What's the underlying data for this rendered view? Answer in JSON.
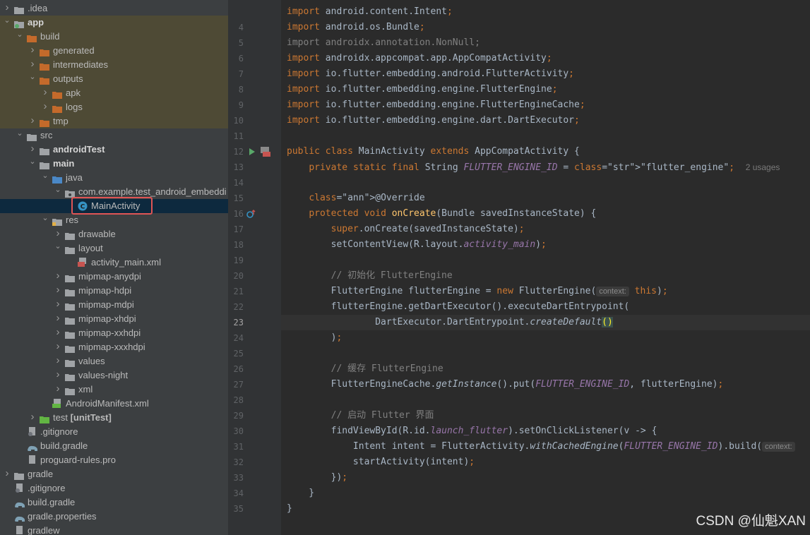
{
  "project_tree": [
    {
      "label": ".idea",
      "depth": 0,
      "arrow": "collapsed",
      "icon": "folder",
      "bold": false,
      "hl": false
    },
    {
      "label": "app",
      "depth": 0,
      "arrow": "expanded",
      "icon": "module",
      "bold": true,
      "hl": true
    },
    {
      "label": "build",
      "depth": 1,
      "arrow": "expanded",
      "icon": "folder-orange",
      "bold": false,
      "hl": true
    },
    {
      "label": "generated",
      "depth": 2,
      "arrow": "collapsed",
      "icon": "folder-orange",
      "bold": false,
      "hl": true
    },
    {
      "label": "intermediates",
      "depth": 2,
      "arrow": "collapsed",
      "icon": "folder-orange",
      "bold": false,
      "hl": true
    },
    {
      "label": "outputs",
      "depth": 2,
      "arrow": "expanded",
      "icon": "folder-orange",
      "bold": false,
      "hl": true
    },
    {
      "label": "apk",
      "depth": 3,
      "arrow": "collapsed",
      "icon": "folder-orange",
      "bold": false,
      "hl": true
    },
    {
      "label": "logs",
      "depth": 3,
      "arrow": "collapsed",
      "icon": "folder-orange",
      "bold": false,
      "hl": true
    },
    {
      "label": "tmp",
      "depth": 2,
      "arrow": "collapsed",
      "icon": "folder-orange",
      "bold": false,
      "hl": true
    },
    {
      "label": "src",
      "depth": 1,
      "arrow": "expanded",
      "icon": "folder",
      "bold": false,
      "hl": false
    },
    {
      "label": "androidTest",
      "depth": 2,
      "arrow": "collapsed",
      "icon": "folder",
      "bold": true,
      "hl": false
    },
    {
      "label": "main",
      "depth": 2,
      "arrow": "expanded",
      "icon": "folder",
      "bold": true,
      "hl": false
    },
    {
      "label": "java",
      "depth": 3,
      "arrow": "expanded",
      "icon": "folder-src",
      "bold": false,
      "hl": false
    },
    {
      "label": "com.example.test_android_embeddi",
      "depth": 4,
      "arrow": "expanded",
      "icon": "package",
      "bold": false,
      "hl": false
    },
    {
      "label": "MainActivity",
      "depth": 5,
      "arrow": "none",
      "icon": "class",
      "bold": false,
      "hl": false,
      "sel": true
    },
    {
      "label": "res",
      "depth": 3,
      "arrow": "expanded",
      "icon": "folder-res",
      "bold": false,
      "hl": false
    },
    {
      "label": "drawable",
      "depth": 4,
      "arrow": "collapsed",
      "icon": "folder",
      "bold": false,
      "hl": false
    },
    {
      "label": "layout",
      "depth": 4,
      "arrow": "expanded",
      "icon": "folder",
      "bold": false,
      "hl": false
    },
    {
      "label": "activity_main.xml",
      "depth": 5,
      "arrow": "none",
      "icon": "xml",
      "bold": false,
      "hl": false
    },
    {
      "label": "mipmap-anydpi",
      "depth": 4,
      "arrow": "collapsed",
      "icon": "folder",
      "bold": false,
      "hl": false
    },
    {
      "label": "mipmap-hdpi",
      "depth": 4,
      "arrow": "collapsed",
      "icon": "folder",
      "bold": false,
      "hl": false
    },
    {
      "label": "mipmap-mdpi",
      "depth": 4,
      "arrow": "collapsed",
      "icon": "folder",
      "bold": false,
      "hl": false
    },
    {
      "label": "mipmap-xhdpi",
      "depth": 4,
      "arrow": "collapsed",
      "icon": "folder",
      "bold": false,
      "hl": false
    },
    {
      "label": "mipmap-xxhdpi",
      "depth": 4,
      "arrow": "collapsed",
      "icon": "folder",
      "bold": false,
      "hl": false
    },
    {
      "label": "mipmap-xxxhdpi",
      "depth": 4,
      "arrow": "collapsed",
      "icon": "folder",
      "bold": false,
      "hl": false
    },
    {
      "label": "values",
      "depth": 4,
      "arrow": "collapsed",
      "icon": "folder",
      "bold": false,
      "hl": false
    },
    {
      "label": "values-night",
      "depth": 4,
      "arrow": "collapsed",
      "icon": "folder",
      "bold": false,
      "hl": false
    },
    {
      "label": "xml",
      "depth": 4,
      "arrow": "collapsed",
      "icon": "folder",
      "bold": false,
      "hl": false
    },
    {
      "label": "AndroidManifest.xml",
      "depth": 3,
      "arrow": "none",
      "icon": "manifest",
      "bold": false,
      "hl": false
    },
    {
      "label": "test",
      "label_bold": "[unitTest]",
      "depth": 2,
      "arrow": "collapsed",
      "icon": "folder-test",
      "bold": false,
      "hl": false
    },
    {
      "label": ".gitignore",
      "depth": 1,
      "arrow": "none",
      "icon": "gitignore",
      "bold": false,
      "hl": false
    },
    {
      "label": "build.gradle",
      "depth": 1,
      "arrow": "none",
      "icon": "gradle",
      "bold": false,
      "hl": false
    },
    {
      "label": "proguard-rules.pro",
      "depth": 1,
      "arrow": "none",
      "icon": "file",
      "bold": false,
      "hl": false
    },
    {
      "label": "gradle",
      "depth": 0,
      "arrow": "collapsed",
      "icon": "folder",
      "bold": false,
      "hl": false
    },
    {
      "label": ".gitignore",
      "depth": 0,
      "arrow": "none",
      "icon": "gitignore",
      "bold": false,
      "hl": false
    },
    {
      "label": "build.gradle",
      "depth": 0,
      "arrow": "none",
      "icon": "gradle",
      "bold": false,
      "hl": false
    },
    {
      "label": "gradle.properties",
      "depth": 0,
      "arrow": "none",
      "icon": "gradle",
      "bold": false,
      "hl": false
    },
    {
      "label": "gradlew",
      "depth": 0,
      "arrow": "none",
      "icon": "file",
      "bold": false,
      "hl": false
    }
  ],
  "editor": {
    "line_numbers": [
      "4",
      "5",
      "6",
      "7",
      "8",
      "9",
      "10",
      "11",
      "12",
      "13",
      "14",
      "15",
      "16",
      "17",
      "18",
      "19",
      "20",
      "21",
      "22",
      "23",
      "24",
      "25",
      "26",
      "27",
      "28",
      "29",
      "30",
      "31",
      "32",
      "33",
      "34",
      "35"
    ],
    "current_line": "23",
    "lines": [
      {
        "t": "import android.content.Intent;"
      },
      {
        "t": "import android.os.Bundle;"
      },
      {
        "t": "import androidx.annotation.NonNull;",
        "unused": true
      },
      {
        "t": "import androidx.appcompat.app.AppCompatActivity;"
      },
      {
        "t": "import io.flutter.embedding.android.FlutterActivity;"
      },
      {
        "t": "import io.flutter.embedding.engine.FlutterEngine;"
      },
      {
        "t": "import io.flutter.embedding.engine.FlutterEngineCache;"
      },
      {
        "t": "import io.flutter.embedding.engine.dart.DartExecutor;"
      },
      {
        "t": ""
      },
      {
        "t": "public class MainActivity extends AppCompatActivity {"
      },
      {
        "t": "    private static final String FLUTTER_ENGINE_ID = \"flutter_engine\";"
      },
      {
        "t": ""
      },
      {
        "t": "    @Override"
      },
      {
        "t": "    protected void onCreate(Bundle savedInstanceState) {"
      },
      {
        "t": "        super.onCreate(savedInstanceState);"
      },
      {
        "t": "        setContentView(R.layout.activity_main);"
      },
      {
        "t": ""
      },
      {
        "t": "        // 初始化 FlutterEngine"
      },
      {
        "t": "        FlutterEngine flutterEngine = new FlutterEngine(this);"
      },
      {
        "t": "        flutterEngine.getDartExecutor().executeDartEntrypoint("
      },
      {
        "t": "                DartExecutor.DartEntrypoint.createDefault()"
      },
      {
        "t": "        );"
      },
      {
        "t": ""
      },
      {
        "t": "        // 缓存 FlutterEngine"
      },
      {
        "t": "        FlutterEngineCache.getInstance().put(FLUTTER_ENGINE_ID, flutterEngine);"
      },
      {
        "t": ""
      },
      {
        "t": "        // 启动 Flutter 界面"
      },
      {
        "t": "        findViewById(R.id.launch_flutter).setOnClickListener(v -> {"
      },
      {
        "t": "            Intent intent = FlutterActivity.withCachedEngine(FLUTTER_ENGINE_ID).build("
      },
      {
        "t": "            startActivity(intent);"
      },
      {
        "t": "        });"
      },
      {
        "t": "    }"
      },
      {
        "t": "}"
      }
    ],
    "usages_hint": "2 usages",
    "param_hint": "context:",
    "param_hint_trailing": "context:"
  },
  "watermark": "CSDN @仙魁XAN",
  "colors": {
    "sidebar_bg": "#3c3f41",
    "editor_bg": "#2b2b2b",
    "highlight_bg": "#4e4a35",
    "selected_bg": "#0d293e",
    "selection_border": "#e05555"
  }
}
